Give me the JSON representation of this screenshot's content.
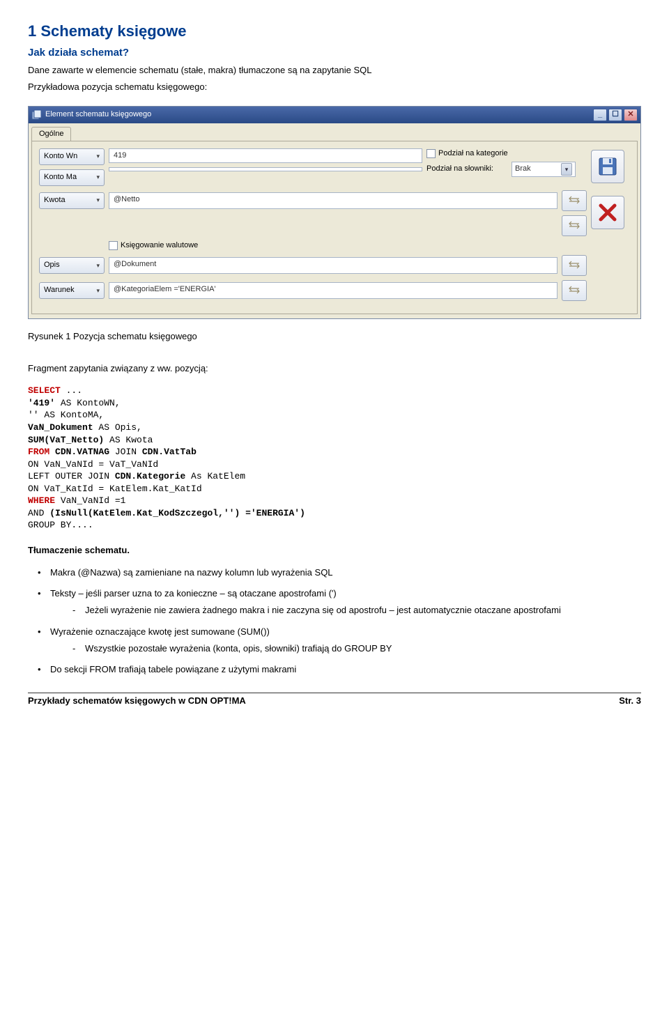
{
  "heading1": "1 Schematy księgowe",
  "heading2": "Jak działa schemat?",
  "intro_line": "Dane zawarte w elemencie schematu (stałe, makra) tłumaczone są na zapytanie SQL",
  "caption_label": "Przykładowa pozycja schematu księgowego:",
  "window": {
    "title": "Element schematu księgowego",
    "tab": "Ogólne",
    "rows": {
      "konto_wn": {
        "label": "Konto Wn",
        "value": "419"
      },
      "konto_ma": {
        "label": "Konto Ma",
        "value": ""
      },
      "kwota": {
        "label": "Kwota",
        "value": "@Netto"
      },
      "opis": {
        "label": "Opis",
        "value": "@Dokument"
      },
      "warunek": {
        "label": "Warunek",
        "value": "@KategoriaElem ='ENERGIA'"
      }
    },
    "podzial_kategorie": "Podział na kategorie",
    "podzial_slowniki": "Podział na słowniki:",
    "slownik_value": "Brak",
    "ksiegowanie_walutowe": "Księgowanie walutowe"
  },
  "fig_caption": "Rysunek 1   Pozycja schematu księgowego",
  "fragment_label": "Fragment zapytania związany z ww. pozycją:",
  "code": {
    "l1a": "SELECT",
    "l1b": " ...",
    "l2a": "'419'",
    "l2b": " AS KontoWN,",
    "l3": "'' AS KontoMA,",
    "l4a": "VaN_Dokument",
    "l4b": " AS Opis,",
    "l5a": "SUM(VaT_Netto)",
    "l5b": " AS Kwota",
    "l6a": "FROM",
    "l6b": " CDN.VATNAG",
    "l6c": " JOIN ",
    "l6d": "CDN.VatTab",
    "l7": "ON VaN_VaNId = VaT_VaNId",
    "l8a": "LEFT OUTER JOIN ",
    "l8b": "CDN.Kategorie",
    "l8c": " As KatElem",
    "l9": "ON VaT_KatId = KatElem.Kat_KatId",
    "l10a": "WHERE",
    "l10b": " VaN_VaNId =1",
    "l11a": "AND ",
    "l11b": "(IsNull(KatElem.Kat_KodSzczegol,'') ='ENERGIA')",
    "l12": "GROUP BY...."
  },
  "translation_heading": "Tłumaczenie schematu.",
  "bullets": {
    "b1": "Makra (@Nazwa) są zamieniane na nazwy kolumn lub wyrażenia SQL",
    "b2": "Teksty – jeśli parser uzna to za konieczne – są otaczane apostrofami (')",
    "b2_sub": "Jeżeli wyrażenie nie zawiera żadnego makra i nie zaczyna się od apostrofu – jest automatycznie otaczane apostrofami",
    "b3": "Wyrażenie oznaczające kwotę jest sumowane (SUM())",
    "b3_sub": "Wszystkie pozostałe wyrażenia (konta, opis, słowniki) trafiają do GROUP BY",
    "b4": "Do sekcji FROM trafiają tabele powiązane z użytymi makrami"
  },
  "footer": {
    "title": "Przykłady schematów księgowych w CDN OPT!MA",
    "page": "Str. 3"
  }
}
